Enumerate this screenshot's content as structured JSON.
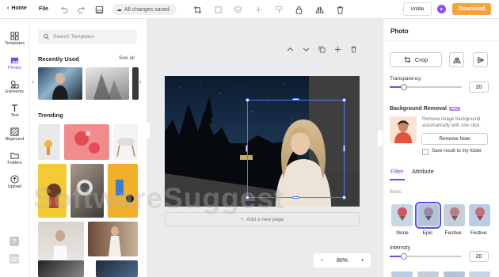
{
  "topbar": {
    "home_label": "Home",
    "file_label": "File",
    "saved_status": "All changes saved",
    "doc_title": "Untitle",
    "download_label": "Download"
  },
  "rail": {
    "items": [
      {
        "label": "Templates",
        "icon": "grid-icon"
      },
      {
        "label": "Photos",
        "icon": "image-icon"
      },
      {
        "label": "Elements",
        "icon": "elements-icon"
      },
      {
        "label": "Text",
        "icon": "text-icon"
      },
      {
        "label": "Bkground",
        "icon": "background-icon"
      },
      {
        "label": "Folders",
        "icon": "folder-icon"
      },
      {
        "label": "Upload",
        "icon": "upload-icon"
      }
    ],
    "help_label": "?"
  },
  "templates": {
    "search_placeholder": "Search Templates",
    "recently_used_title": "Recently Used",
    "see_all_label": "See all",
    "trending_title": "Trending"
  },
  "canvas": {
    "add_page_label": "Add a new page",
    "zoom_value": "80%",
    "zoom_minus": "−",
    "zoom_plus": "+"
  },
  "right_panel": {
    "title": "Photo",
    "crop_label": "Crop",
    "transparency_label": "Transparency",
    "transparency_value": "20",
    "transparency_level": 0.2,
    "bg_removal_title": "Background Removal",
    "pro_badge": "PRO",
    "bg_removal_desc": "Remove image background automatically with one click.",
    "remove_now_label": "Remove Now",
    "save_result_label": "Save result to my folder",
    "tabs": [
      "Filter",
      "Attribute"
    ],
    "filter_section_label": "Basic",
    "filters": [
      "None",
      "Epic",
      "Festive",
      "Festive"
    ],
    "intensity_label": "Intensity",
    "intensity_value": "20",
    "intensity_level": 0.2
  },
  "watermark": "SoftwareSuggest",
  "colors": {
    "accent": "#6a4cf5",
    "download": "#f7a23b",
    "selection": "#4d7cf4"
  }
}
